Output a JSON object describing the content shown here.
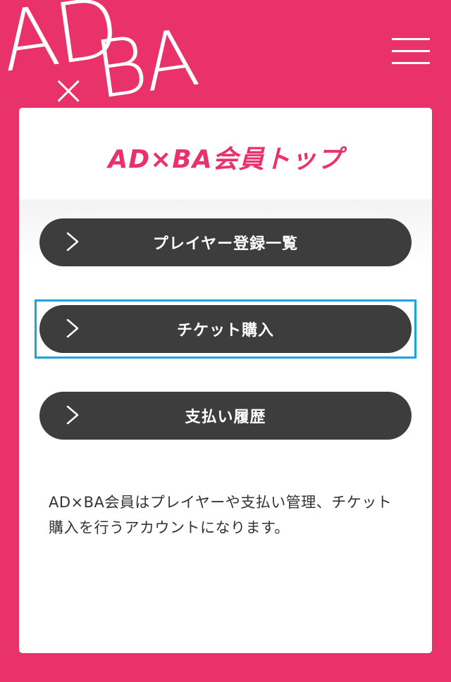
{
  "logo": {
    "part1": "AD",
    "part2": "×",
    "part3": "BA"
  },
  "header": {
    "menu_icon": "hamburger-menu-icon"
  },
  "card": {
    "title": "AD×BA会員トップ"
  },
  "buttons": [
    {
      "label": "プレイヤー登録一覧",
      "icon": "chevron-right-icon"
    },
    {
      "label": "チケット購入",
      "icon": "chevron-right-icon"
    },
    {
      "label": "支払い履歴",
      "icon": "chevron-right-icon"
    }
  ],
  "description": "AD×BA会員はプレイヤーや支払い管理、チケット購入を行うアカウントになります。",
  "colors": {
    "brand_pink": "#e9316a",
    "button_dark": "#3d3d3d",
    "focus_blue": "#1ea4dc",
    "card_white": "#ffffff"
  }
}
